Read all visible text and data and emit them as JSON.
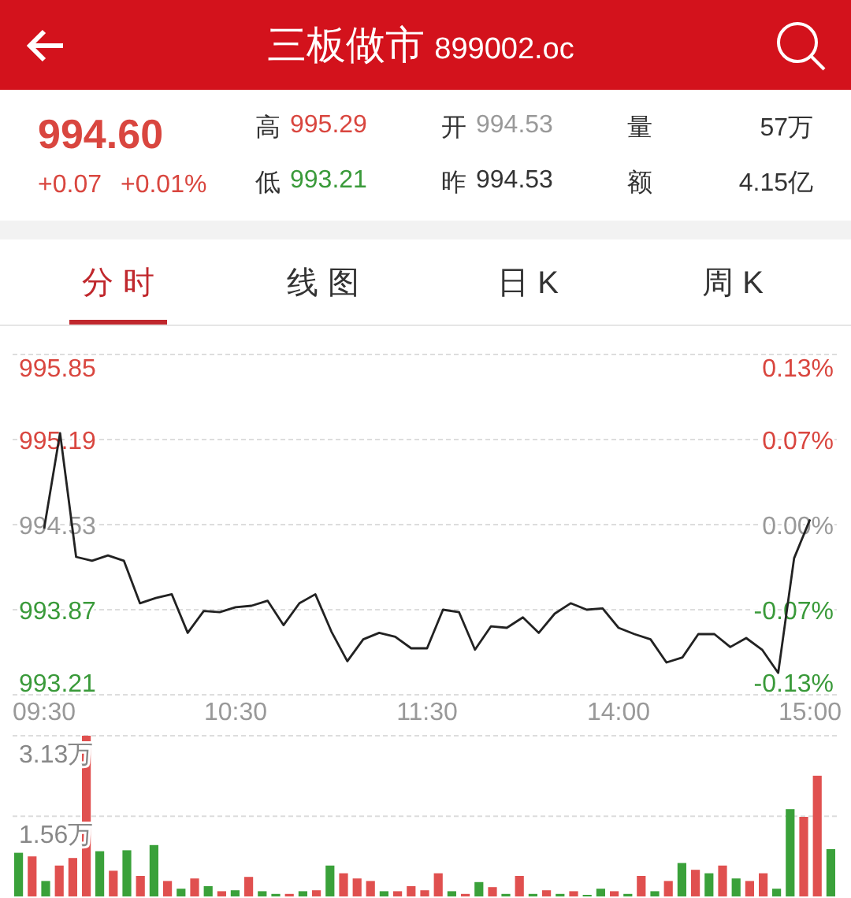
{
  "header": {
    "title": "三板做市",
    "code": "899002.oc"
  },
  "quote": {
    "price": "994.60",
    "change": "+0.07",
    "change_percent": "+0.01%",
    "stats": [
      {
        "label": "高",
        "value": "995.29",
        "color": "#d9463f"
      },
      {
        "label": "开",
        "value": "994.53",
        "color": "#999999"
      },
      {
        "label": "量",
        "value": "57万",
        "color": "#333333"
      },
      {
        "label": "低",
        "value": "993.21",
        "color": "#3a9a3a"
      },
      {
        "label": "昨",
        "value": "994.53",
        "color": "#333333"
      },
      {
        "label": "额",
        "value": "4.15亿",
        "color": "#333333"
      }
    ]
  },
  "tabs": [
    {
      "label": "分 时",
      "selected": true
    },
    {
      "label": "线 图",
      "selected": false
    },
    {
      "label": "日 K",
      "selected": false
    },
    {
      "label": "周 K",
      "selected": false
    }
  ],
  "price_chart": {
    "percent_labels": [
      "0.13%",
      "0.07%",
      "0.00%",
      "-0.07%",
      "-0.13%"
    ],
    "chart_data": {
      "type": "line",
      "grid": true,
      "ylim": [
        993.21,
        995.85
      ],
      "categories": [
        "09:30",
        null,
        null,
        null,
        null,
        null,
        null,
        null,
        null,
        null,
        null,
        null,
        "10:30",
        null,
        null,
        null,
        null,
        null,
        null,
        null,
        null,
        null,
        null,
        null,
        "11:30",
        null,
        null,
        null,
        null,
        null,
        null,
        null,
        null,
        null,
        null,
        null,
        "14:00",
        null,
        null,
        null,
        null,
        null,
        null,
        null,
        null,
        null,
        null,
        null,
        "15:00"
      ],
      "yticks": [
        {
          "value": 995.85,
          "label": "995.85"
        },
        {
          "value": 995.19,
          "label": "995.19"
        },
        {
          "value": 994.53,
          "label": "994.53"
        },
        {
          "value": 993.87,
          "label": "993.87"
        },
        {
          "value": 993.21,
          "label": "993.21"
        }
      ],
      "series": [
        {
          "color": "#222222",
          "values": [
            994.5,
            995.24,
            994.28,
            994.25,
            994.29,
            994.25,
            993.92,
            993.96,
            993.99,
            993.69,
            993.86,
            993.85,
            993.89,
            993.9,
            993.94,
            993.75,
            993.92,
            993.99,
            993.7,
            993.47,
            993.64,
            993.69,
            993.66,
            993.57,
            993.57,
            993.87,
            993.85,
            993.56,
            993.74,
            993.73,
            993.81,
            993.69,
            993.84,
            993.92,
            993.87,
            993.88,
            993.73,
            993.68,
            993.64,
            993.46,
            993.5,
            993.68,
            993.68,
            993.58,
            993.65,
            993.56,
            993.38,
            994.27,
            994.57
          ]
        }
      ]
    }
  },
  "volume_chart": {
    "chart_data": {
      "type": "bar",
      "stacked": true,
      "ylim": [
        0,
        3.13
      ],
      "categories": [
        null,
        null,
        null,
        null,
        null,
        null,
        null,
        null,
        null,
        null,
        null,
        null,
        null,
        null,
        null,
        null,
        null,
        null,
        null,
        null,
        null,
        null,
        null,
        null,
        null,
        null,
        null,
        null,
        null,
        null,
        null,
        null,
        null,
        null,
        null,
        null,
        null,
        null,
        null,
        null,
        null,
        null,
        null,
        null,
        null,
        null,
        null,
        null,
        null,
        null,
        null,
        null,
        null,
        null,
        null,
        null,
        null,
        null,
        null,
        null,
        null
      ],
      "yticks": [
        {
          "value": 3.13,
          "label": "3.13万"
        },
        {
          "value": 1.56,
          "label": "1.56万"
        }
      ],
      "series": [
        {
          "color": "#e0504f",
          "values": [
            null,
            0.78,
            null,
            0.6,
            0.75,
            3.13,
            null,
            0.5,
            null,
            0.4,
            null,
            0.3,
            null,
            0.35,
            null,
            0.1,
            null,
            0.38,
            null,
            null,
            0.05,
            null,
            0.12,
            null,
            0.45,
            0.35,
            0.3,
            null,
            0.1,
            0.2,
            0.12,
            0.45,
            null,
            0.05,
            null,
            0.18,
            null,
            0.4,
            null,
            0.12,
            null,
            0.1,
            null,
            null,
            0.1,
            null,
            0.4,
            null,
            0.3,
            null,
            0.52,
            null,
            0.6,
            null,
            0.3,
            0.45,
            null,
            null,
            1.55,
            2.35,
            null
          ]
        },
        {
          "color": "#3aa13a",
          "values": [
            0.85,
            null,
            0.3,
            null,
            null,
            null,
            0.88,
            null,
            0.9,
            null,
            1.0,
            null,
            0.15,
            null,
            0.2,
            null,
            0.12,
            null,
            0.1,
            0.05,
            null,
            0.1,
            null,
            0.6,
            null,
            null,
            null,
            0.1,
            null,
            null,
            null,
            null,
            0.1,
            null,
            0.28,
            null,
            0.05,
            null,
            0.05,
            null,
            0.05,
            null,
            0.03,
            0.15,
            null,
            0.05,
            null,
            0.1,
            null,
            0.65,
            null,
            0.45,
            null,
            0.35,
            null,
            null,
            0.15,
            1.7,
            null,
            null,
            0.92
          ]
        }
      ]
    }
  }
}
